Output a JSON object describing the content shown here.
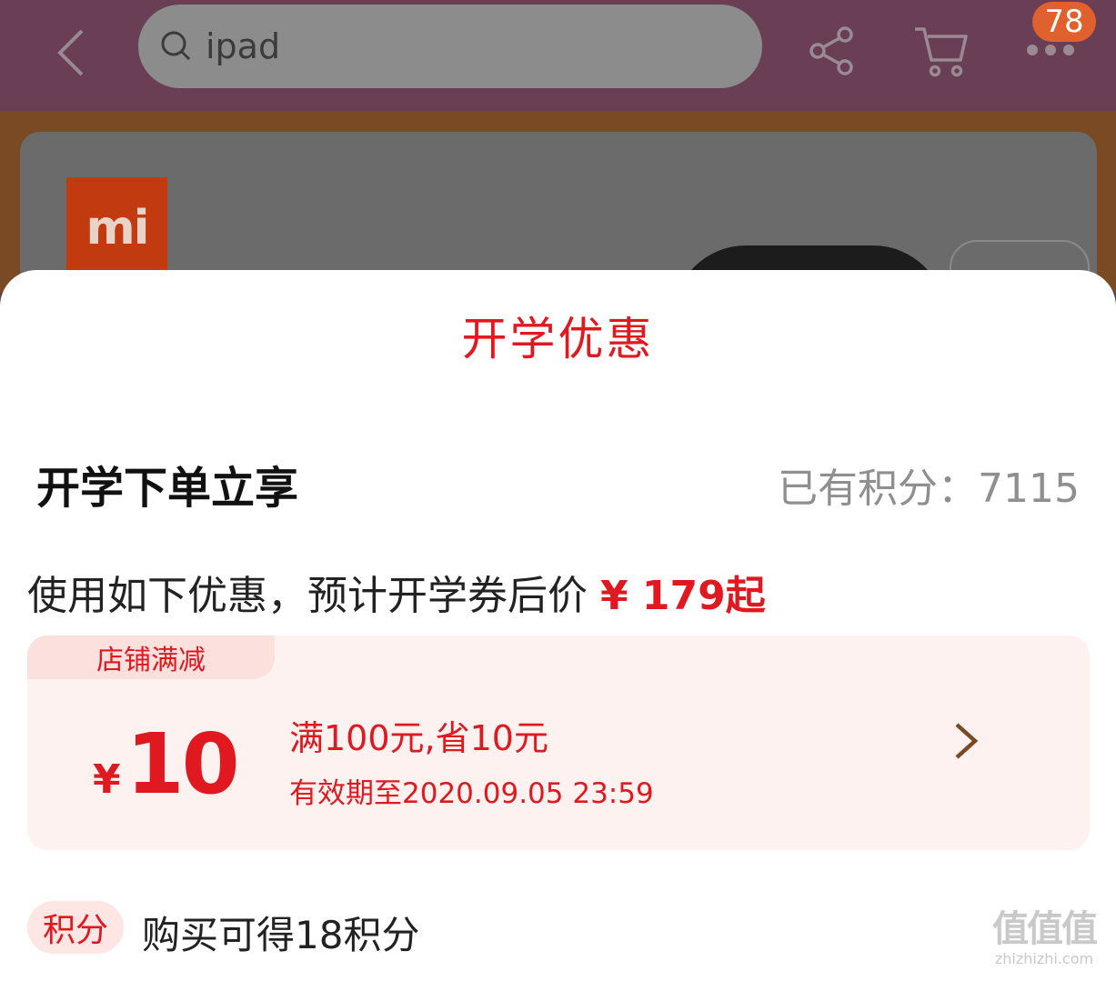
{
  "header": {
    "search_text": "ipad",
    "cart_badge": "78"
  },
  "brand": {
    "logo_text": "mi"
  },
  "sheet": {
    "title": "开学优惠",
    "subtitle": "开学下单立享",
    "points_label": "已有积分：",
    "points_value": "7115",
    "price_prefix": "使用如下优惠，预计开学券后价",
    "price_value": "¥ 179起"
  },
  "coupon": {
    "tag": "店铺满减",
    "currency": "¥",
    "amount": "10",
    "rule": "满100元,省10元",
    "valid_until": "有效期至2020.09.05 23:59"
  },
  "points_reward": {
    "tag": "积分",
    "text": "购买可得18积分"
  },
  "watermark": {
    "big": "值值值",
    "small": "zhizhizhi.com"
  },
  "colors": {
    "accent": "#e0181f",
    "coupon_bg": "#fdf2ef"
  }
}
